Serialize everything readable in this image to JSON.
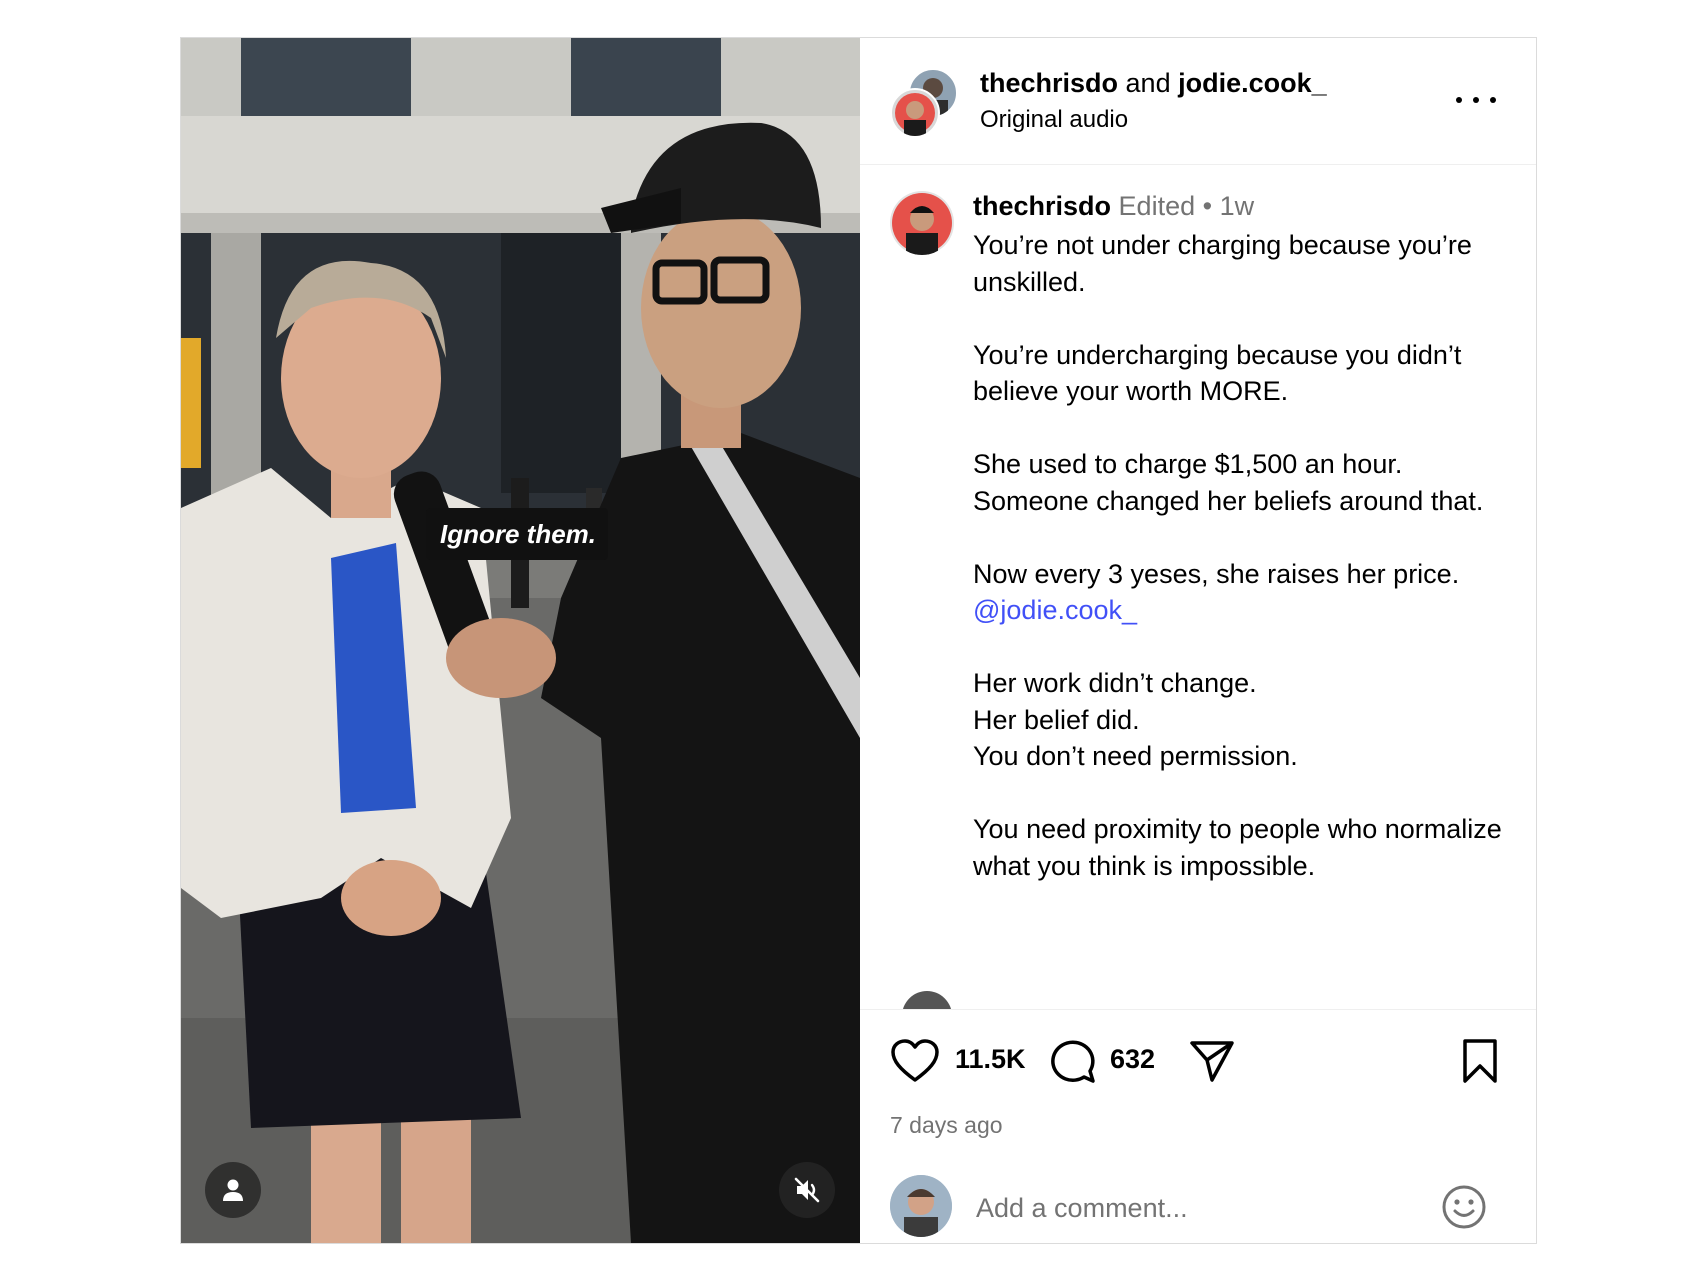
{
  "media": {
    "overlay_caption": "Ignore them.",
    "tag_button_icon": "user-tag-icon",
    "mute_button_icon": "speaker-muted-icon"
  },
  "header": {
    "author_primary": "thechrisdo",
    "joiner": " and ",
    "author_secondary": "jodie.cook_",
    "audio_label": "Original audio",
    "more_icon": "more-horizontal-icon"
  },
  "caption": {
    "username": "thechrisdo",
    "edited_label": "Edited",
    "separator": "•",
    "age": "1w",
    "paragraphs": [
      "You’re not under charging because you’re unskilled.",
      "You’re undercharging because you didn’t believe your worth MORE.",
      "She used to charge $1,500 an hour.\nSomeone changed her beliefs around that.",
      "Now every 3 yeses, she raises her price."
    ],
    "mention": "@jodie.cook_",
    "paragraphs_after": [
      "Her work didn’t change.\nHer belief did.\nYou don’t need permission.",
      "You need proximity to people who normalize what you think is impossible."
    ]
  },
  "actions": {
    "like_icon": "heart-icon",
    "like_count": "11.5K",
    "comment_icon": "comment-bubble-icon",
    "comment_count": "632",
    "share_icon": "paper-plane-icon",
    "save_icon": "bookmark-icon",
    "timestamp": "7 days ago"
  },
  "composer": {
    "placeholder": "Add a comment...",
    "emoji_icon": "smiley-icon"
  },
  "colors": {
    "mention": "#4150f7",
    "secondary_text": "#737373",
    "border": "#dbdbdb"
  }
}
